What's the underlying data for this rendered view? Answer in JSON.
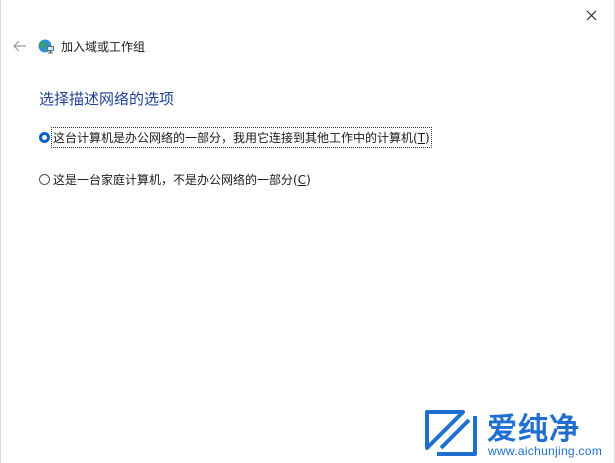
{
  "window": {
    "title": "加入域或工作组",
    "close_icon": "close-icon",
    "back_icon": "back-arrow-icon",
    "app_icon": "network-globe-icon"
  },
  "main": {
    "heading": "选择描述网络的选项",
    "options": [
      {
        "label": "这台计算机是办公网络的一部分，我用它连接到其他工作中的计算机(",
        "mnemonic": "T",
        "suffix": ")",
        "checked": true
      },
      {
        "label": "这是一台家庭计算机，不是办公网络的一部分(",
        "mnemonic": "C",
        "suffix": ")",
        "checked": false
      }
    ]
  },
  "watermark": {
    "brand": "爱纯净",
    "url": "www.aichunjing.com",
    "color": "#1e6fcf"
  }
}
